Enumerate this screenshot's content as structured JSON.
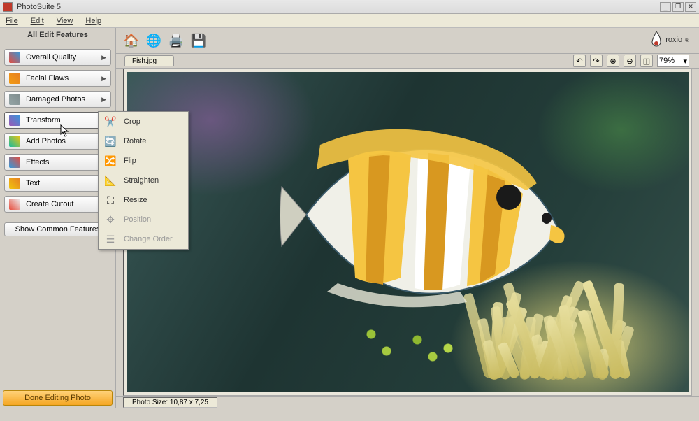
{
  "window": {
    "title": "PhotoSuite 5"
  },
  "menu": {
    "items": [
      "File",
      "Edit",
      "View",
      "Help"
    ]
  },
  "sidebar": {
    "header": "All Edit Features",
    "buttons": [
      {
        "label": "Overall Quality"
      },
      {
        "label": "Facial Flaws"
      },
      {
        "label": "Damaged Photos"
      },
      {
        "label": "Transform"
      },
      {
        "label": "Add Photos"
      },
      {
        "label": "Effects"
      },
      {
        "label": "Text"
      },
      {
        "label": "Create Cutout"
      }
    ],
    "show_common": "Show Common Features",
    "done": "Done Editing Photo"
  },
  "transform_flyout": {
    "items": [
      {
        "label": "Crop",
        "enabled": true
      },
      {
        "label": "Rotate",
        "enabled": true
      },
      {
        "label": "Flip",
        "enabled": true
      },
      {
        "label": "Straighten",
        "enabled": true
      },
      {
        "label": "Resize",
        "enabled": true
      },
      {
        "label": "Position",
        "enabled": false
      },
      {
        "label": "Change Order",
        "enabled": false
      }
    ]
  },
  "toolbar": {
    "icons": [
      "home",
      "library",
      "print",
      "save"
    ]
  },
  "brand": {
    "name": "roxio"
  },
  "document": {
    "tab": "Fish.jpg"
  },
  "zoom": {
    "value": "79%",
    "controls": [
      "undo",
      "redo",
      "zoom-in",
      "zoom-out",
      "fit"
    ]
  },
  "status": {
    "photo_size": "Photo Size: 10,87 x 7,25"
  }
}
